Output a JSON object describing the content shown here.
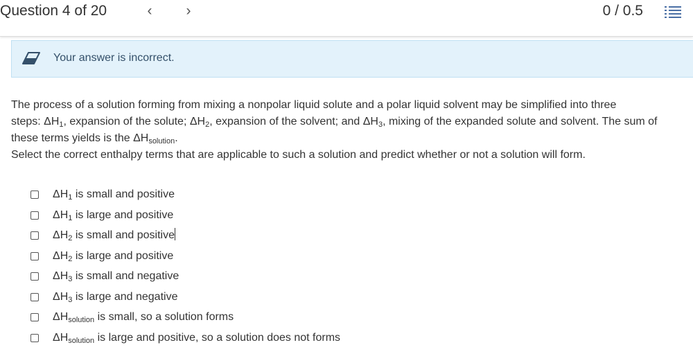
{
  "header": {
    "question_label": "Question 4 of 20",
    "prev_icon": "‹",
    "next_icon": "›",
    "score": "0 / 0.5",
    "list_icon": "question-list-icon"
  },
  "feedback": {
    "icon": "eraser-icon",
    "message": "Your answer is incorrect."
  },
  "question": {
    "line1": "The process of a solution forming from mixing a nonpolar liquid solute and a polar liquid solvent may be simplified into three",
    "steps_prefix": "steps: ΔH",
    "sub_1": "1",
    "steps_mid1": ", expansion of the solute; ΔH",
    "sub_2": "2",
    "steps_mid2": ", expansion of the solvent; and ΔH",
    "sub_3": "3",
    "steps_end": ", mixing of the expanded solute and solvent.  The sum of",
    "line3_prefix": "these terms yields is the ΔH",
    "sub_solution": "solution",
    "line3_end": ".",
    "instruction": "Select the correct enthalpy terms that are applicable to such a solution and predict whether or not a solution will form."
  },
  "options": [
    {
      "base": "ΔH",
      "sub": "1",
      "text": " is small and positive",
      "checked": false
    },
    {
      "base": "ΔH",
      "sub": "1",
      "text": " is large and positive",
      "checked": false
    },
    {
      "base": "ΔH",
      "sub": "2",
      "text": " is small and positive",
      "checked": false
    },
    {
      "base": "ΔH",
      "sub": "2",
      "text": " is large and positive",
      "checked": false
    },
    {
      "base": "ΔH",
      "sub": "3",
      "text": " is small and negative",
      "checked": false
    },
    {
      "base": "ΔH",
      "sub": "3",
      "text": " is large and negative",
      "checked": false
    },
    {
      "base": "ΔH",
      "sub": "solution",
      "text": " is small, so a solution forms",
      "checked": false
    },
    {
      "base": "ΔH",
      "sub": "solution",
      "text": " is large and positive, so a solution does not forms",
      "checked": false
    }
  ],
  "colors": {
    "banner_bg": "#e3f2fb",
    "banner_text": "#34506a",
    "text": "#333333"
  }
}
